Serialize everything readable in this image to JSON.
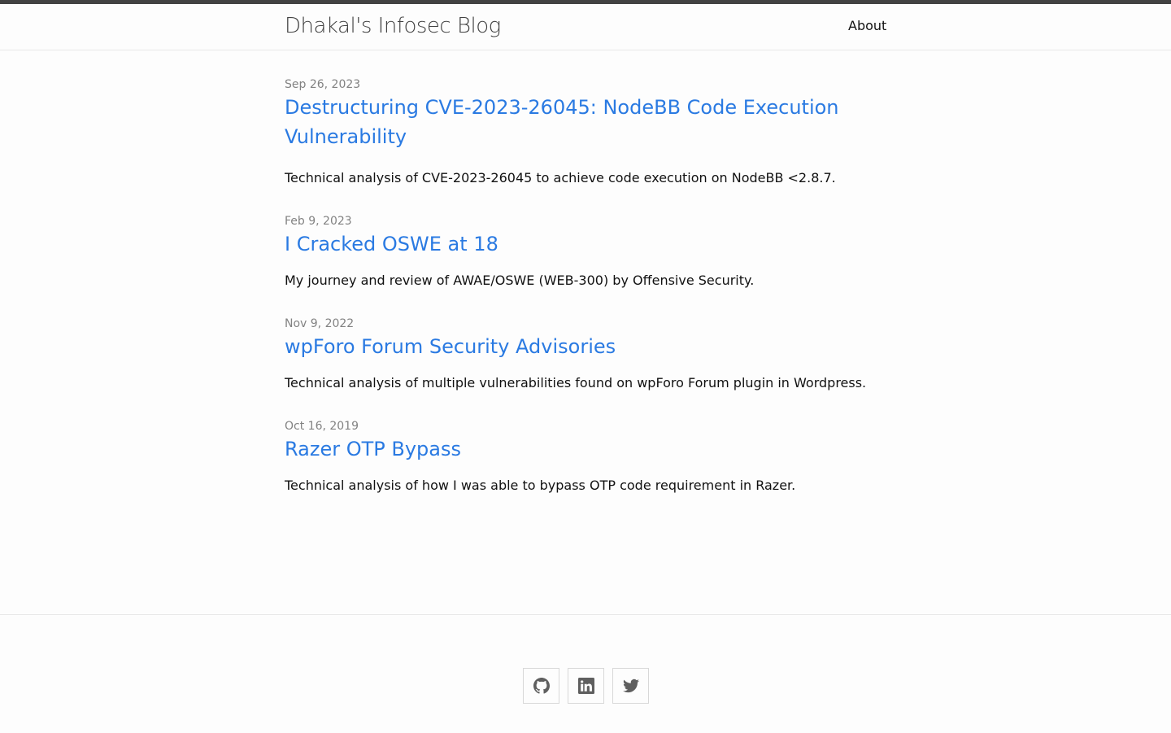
{
  "header": {
    "site_title": "Dhakal's Infosec Blog",
    "nav": [
      {
        "label": "About"
      }
    ]
  },
  "posts": [
    {
      "date": "Sep 26, 2023",
      "title": "Destructuring CVE-2023-26045: NodeBB Code Execution Vulnerability",
      "excerpt": "Technical analysis of CVE-2023-26045 to achieve code execution on NodeBB <2.8.7."
    },
    {
      "date": "Feb 9, 2023",
      "title": "I Cracked OSWE at 18",
      "excerpt": "My journey and review of AWAE/OSWE (WEB-300) by Offensive Security."
    },
    {
      "date": "Nov 9, 2022",
      "title": "wpForo Forum Security Advisories",
      "excerpt": "Technical analysis of multiple vulnerabilities found on wpForo Forum plugin in Wordpress."
    },
    {
      "date": "Oct 16, 2019",
      "title": "Razer OTP Bypass",
      "excerpt": "Technical analysis of how I was able to bypass OTP code requirement in Razer."
    }
  ],
  "footer": {
    "social": [
      {
        "icon": "github-icon"
      },
      {
        "icon": "linkedin-icon"
      },
      {
        "icon": "twitter-icon"
      }
    ]
  },
  "colors": {
    "link": "#2a7ae2",
    "date": "#828282",
    "topbar": "#424242"
  }
}
